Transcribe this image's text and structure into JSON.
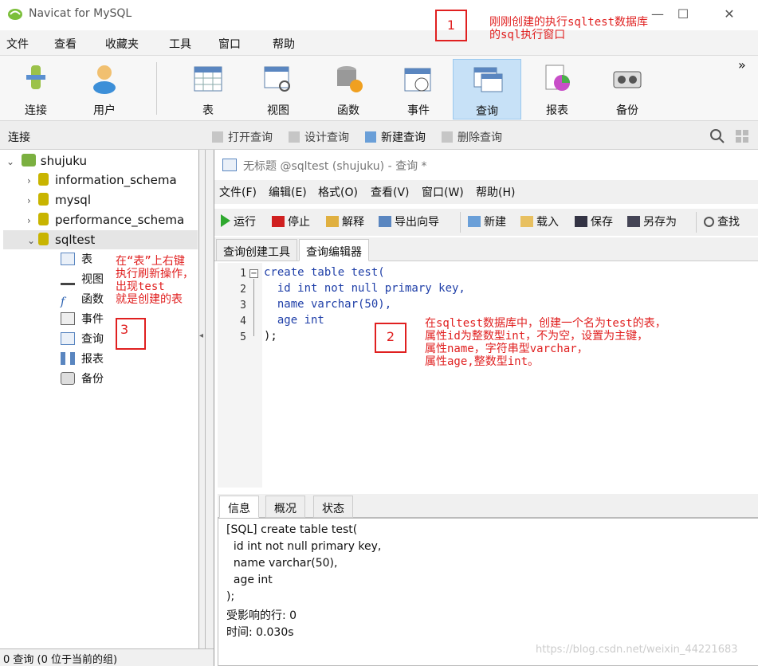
{
  "window": {
    "title": "Navicat for MySQL",
    "min": "—",
    "max": "☐",
    "close": "✕"
  },
  "menubar": [
    "文件",
    "查看",
    "收藏夹",
    "工具",
    "窗口",
    "帮助"
  ],
  "toolbar": {
    "items": [
      {
        "label": "连接",
        "icon": "connect-icon"
      },
      {
        "label": "用户",
        "icon": "user-icon"
      },
      {
        "label": "表",
        "icon": "table-icon"
      },
      {
        "label": "视图",
        "icon": "view-icon"
      },
      {
        "label": "函数",
        "icon": "function-icon"
      },
      {
        "label": "事件",
        "icon": "event-icon"
      },
      {
        "label": "查询",
        "icon": "query-icon",
        "active": true
      },
      {
        "label": "报表",
        "icon": "report-icon"
      },
      {
        "label": "备份",
        "icon": "backup-icon"
      }
    ],
    "overflow": "»"
  },
  "connbar": {
    "label": "连接",
    "actions": [
      "打开查询",
      "设计查询",
      "新建查询",
      "删除查询"
    ]
  },
  "tree": {
    "root": "shujuku",
    "databases": [
      "information_schema",
      "mysql",
      "performance_schema",
      "sqltest"
    ],
    "selected": "sqltest",
    "sqltest_children": [
      "表",
      "视图",
      "函数",
      "事件",
      "查询",
      "报表",
      "备份"
    ]
  },
  "query_window": {
    "title": "无标题 @sqltest (shujuku) - 查询 *",
    "menu": [
      "文件(F)",
      "编辑(E)",
      "格式(O)",
      "查看(V)",
      "窗口(W)",
      "帮助(H)"
    ],
    "toolbar": [
      "运行",
      "停止",
      "解释",
      "导出向导",
      "新建",
      "载入",
      "保存",
      "另存为",
      "查找"
    ],
    "tabs": [
      "查询创建工具",
      "查询编辑器"
    ],
    "active_tab": "查询编辑器",
    "code_lines": [
      "create table test(",
      "  id int not null primary key,",
      "  name varchar(50),",
      "  age int",
      ");"
    ],
    "line_numbers": [
      "1",
      "2",
      "3",
      "4",
      "5"
    ],
    "info_tabs": [
      "信息",
      "概况",
      "状态"
    ],
    "info_lines": [
      "[SQL] create table test(",
      "  id int not null primary key,",
      "  name varchar(50),",
      "  age int",
      ");",
      "受影响的行: 0",
      "时间: 0.030s"
    ]
  },
  "statusbar": {
    "text": "0 查询 (0 位于当前的组)"
  },
  "annotations": {
    "box1": "1",
    "note1": "刚刚创建的执行sqltest数据库\n的sql执行窗口",
    "box2": "2",
    "note2": "在sqltest数据库中，创建一个名为test的表，\n属性id为整数型int，不为空，设置为主键，\n属性name，字符串型varchar，\n属性age,整数型int。",
    "box3": "3",
    "note3": "在“表”上右键\n执行刷新操作，\n出现test\n就是创建的表"
  },
  "watermark": "https://blog.csdn.net/weixin_44221683"
}
